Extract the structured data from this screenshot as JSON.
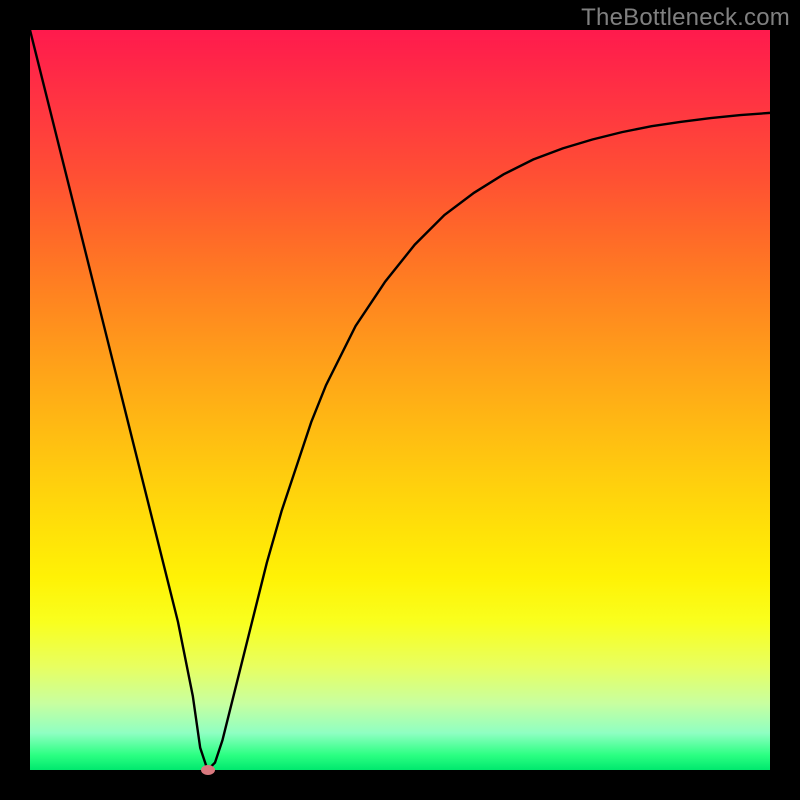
{
  "watermark": "TheBottleneck.com",
  "colors": {
    "frame_bg": "#000000",
    "curve_stroke": "#000000",
    "marker_fill": "#d8787e",
    "watermark_color": "#808080"
  },
  "chart_data": {
    "type": "line",
    "title": "",
    "xlabel": "",
    "ylabel": "",
    "xlim": [
      0,
      100
    ],
    "ylim": [
      0,
      100
    ],
    "x": [
      0,
      2,
      4,
      6,
      8,
      10,
      12,
      14,
      16,
      18,
      20,
      22,
      23,
      24,
      25,
      26,
      28,
      30,
      32,
      34,
      36,
      38,
      40,
      44,
      48,
      52,
      56,
      60,
      64,
      68,
      72,
      76,
      80,
      84,
      88,
      92,
      96,
      100
    ],
    "values": [
      100,
      92,
      84,
      76,
      68,
      60,
      52,
      44,
      36,
      28,
      20,
      10,
      3,
      0,
      1,
      4,
      12,
      20,
      28,
      35,
      41,
      47,
      52,
      60,
      66,
      71,
      75,
      78,
      80.5,
      82.5,
      84,
      85.2,
      86.2,
      87,
      87.6,
      88.1,
      88.5,
      88.8
    ],
    "minimum_marker": {
      "x": 24,
      "y": 0
    },
    "gradient_stops": [
      {
        "pos": 0.0,
        "color": "#ff1a4d"
      },
      {
        "pos": 0.2,
        "color": "#ff5033"
      },
      {
        "pos": 0.44,
        "color": "#ff9d1a"
      },
      {
        "pos": 0.68,
        "color": "#ffe208"
      },
      {
        "pos": 0.86,
        "color": "#e8ff60"
      },
      {
        "pos": 1.0,
        "color": "#00e86e"
      }
    ]
  }
}
